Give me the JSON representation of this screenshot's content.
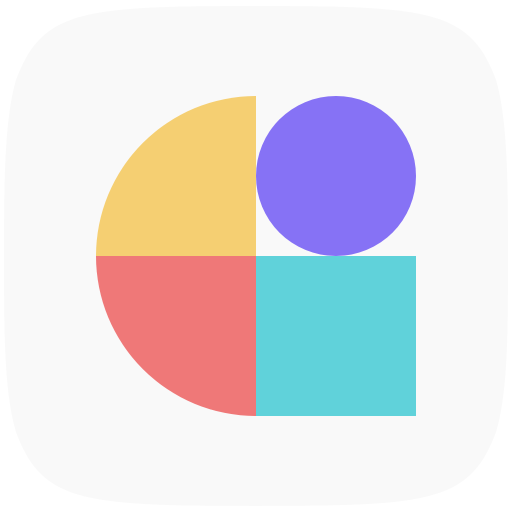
{
  "icon": {
    "name": "app-icon",
    "background_color": "#f9f9f9",
    "shapes": {
      "top_left_quarter_circle": {
        "color": "#f5cf72"
      },
      "bottom_left_quarter_circle": {
        "color": "#ef7878"
      },
      "circle": {
        "color": "#8672f5"
      },
      "square": {
        "color": "#60d2da"
      }
    }
  }
}
